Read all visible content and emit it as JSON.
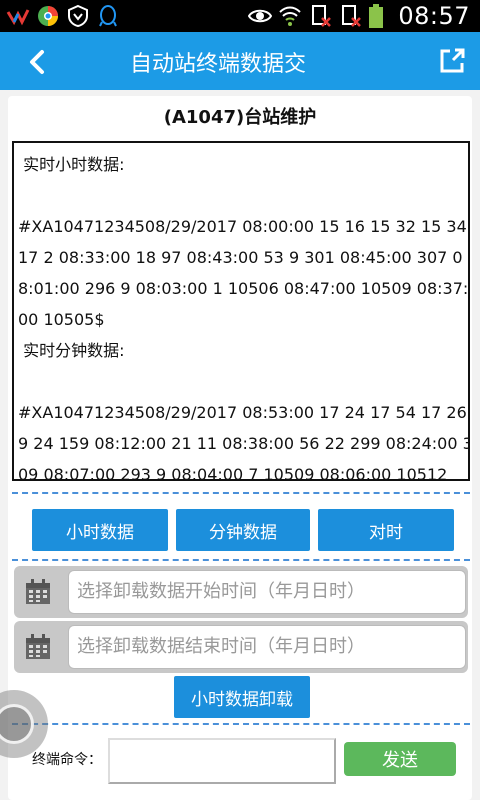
{
  "status_bar": {
    "time": "08:57",
    "left_icons": [
      "app-logo-icon",
      "browser-icon",
      "vpn-shield-icon",
      "qq-icon"
    ],
    "right_icons": [
      "eye-icon",
      "wifi-icon",
      "sim-no-signal-icon",
      "sim-no-signal-icon",
      "battery-icon"
    ]
  },
  "app_bar": {
    "title": "自动站终端数据交",
    "back_icon": "chevron-left-icon",
    "share_icon": "share-external-icon"
  },
  "page": {
    "title": "(A1047)台站维护"
  },
  "data_window": {
    "text": " 实时小时数据:\n\n#XA10471234508/29/2017 08:00:00 15 16 15 32 15 34 17 2 08:33:00 18 97 08:43:00 53 9 301 08:45:00 307 08:01:00 296 9 08:03:00 1 10506 08:47:00 10509 08:37:00 10505$\n 实时分钟数据:\n\n#XA10471234508/29/2017 08:53:00 17 24 17 54 17 269 24 159 08:12:00 21 11 08:38:00 56 22 299 08:24:00 309 08:07:00 293 9 08:04:00 7 10509 08:06:00 10512"
  },
  "buttons": {
    "hour_data": "小时数据",
    "minute_data": "分钟数据",
    "sync_time": "对时",
    "download": "小时数据卸载",
    "send": "发送"
  },
  "pickers": {
    "start_placeholder": "选择卸载数据开始时间（年月日时）",
    "end_placeholder": "选择卸载数据结束时间（年月日时）"
  },
  "command": {
    "label": "终端命令：",
    "value": "",
    "placeholder": ""
  },
  "colors": {
    "app_bar": "#1c9be6",
    "button": "#1c8fdc",
    "send_button": "#5cb85c",
    "dash": "#4a90d9"
  }
}
